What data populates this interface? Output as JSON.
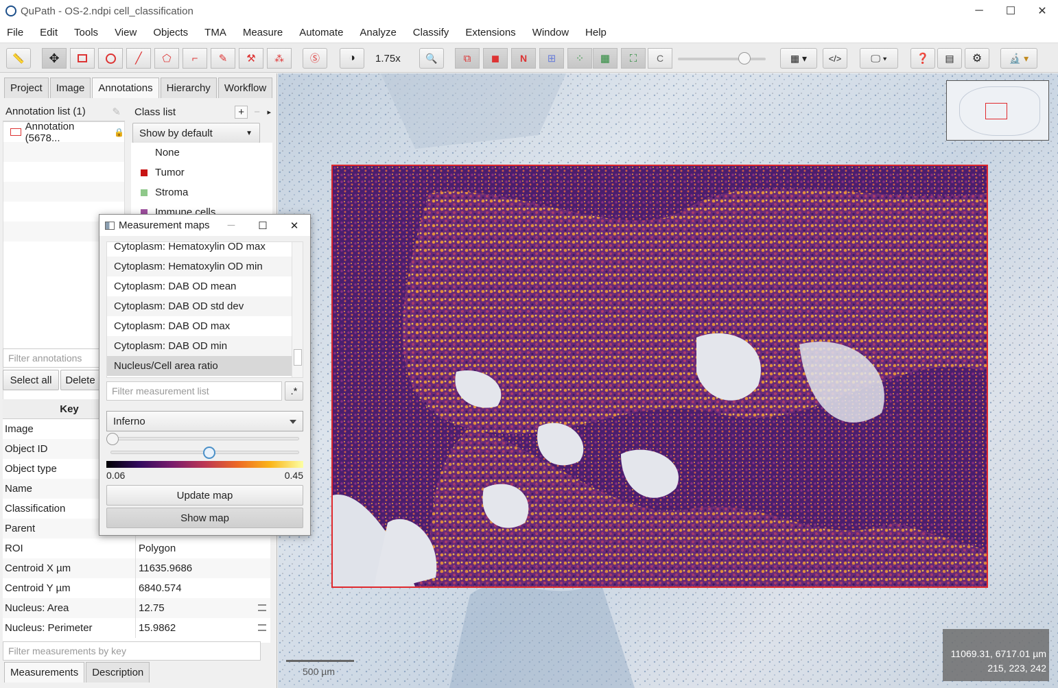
{
  "window": {
    "title": "QuPath - OS-2.ndpi cell_classification",
    "controls": [
      "─",
      "☐",
      "✕"
    ]
  },
  "menu": [
    "File",
    "Edit",
    "Tools",
    "View",
    "Objects",
    "TMA",
    "Measure",
    "Automate",
    "Analyze",
    "Classify",
    "Extensions",
    "Window",
    "Help"
  ],
  "toolbar": {
    "zoom": "1.75x",
    "n_label": "N",
    "c_label": "C"
  },
  "left_tabs": [
    "Project",
    "Image",
    "Annotations",
    "Hierarchy",
    "Workflow"
  ],
  "annotations": {
    "header": "Annotation list (1)",
    "items": [
      "Annotation (5678..."
    ],
    "filter_placeholder": "Filter annotations",
    "select_all": "Select all",
    "delete": "Delete"
  },
  "classes": {
    "header": "Class list",
    "mode": "Show by default",
    "items": [
      {
        "name": "None",
        "color": ""
      },
      {
        "name": "Tumor",
        "color": "#c81414"
      },
      {
        "name": "Stroma",
        "color": "#8fc88a"
      },
      {
        "name": "Immune cells",
        "color": "#a050a0"
      }
    ]
  },
  "measurements": {
    "key_header": "Key",
    "rows": [
      {
        "key": "Image",
        "value": ""
      },
      {
        "key": "Object ID",
        "value": ""
      },
      {
        "key": "Object type",
        "value": ""
      },
      {
        "key": "Name",
        "value": ""
      },
      {
        "key": "Classification",
        "value": ""
      },
      {
        "key": "Parent",
        "value": ""
      },
      {
        "key": "ROI",
        "value": "Polygon"
      },
      {
        "key": "Centroid X µm",
        "value": "11635.9686"
      },
      {
        "key": "Centroid Y µm",
        "value": "6840.574"
      },
      {
        "key": "Nucleus: Area",
        "value": "12.75"
      },
      {
        "key": "Nucleus: Perimeter",
        "value": "15.9862"
      }
    ],
    "filter_placeholder": "Filter measurements by key"
  },
  "bottom_tabs": [
    "Measurements",
    "Description"
  ],
  "viewer": {
    "coords_line1": "11069.31, 6717.01 µm",
    "coords_line2": "215, 223, 242",
    "scale_label": "500 µm"
  },
  "measurement_maps": {
    "title": "Measurement maps",
    "items": [
      "Cytoplasm: Hematoxylin OD max",
      "Cytoplasm: Hematoxylin OD min",
      "Cytoplasm: DAB OD mean",
      "Cytoplasm: DAB OD std dev",
      "Cytoplasm: DAB OD max",
      "Cytoplasm: DAB OD min",
      "Nucleus/Cell area ratio"
    ],
    "selected_index": 6,
    "filter_placeholder": "Filter measurement list",
    "regex_button": ".*",
    "colormap": "Inferno",
    "min_slider_fraction": 0.0,
    "max_slider_fraction": 0.55,
    "min_value": "0.06",
    "max_value": "0.45",
    "update_button": "Update map",
    "show_button": "Show map"
  }
}
